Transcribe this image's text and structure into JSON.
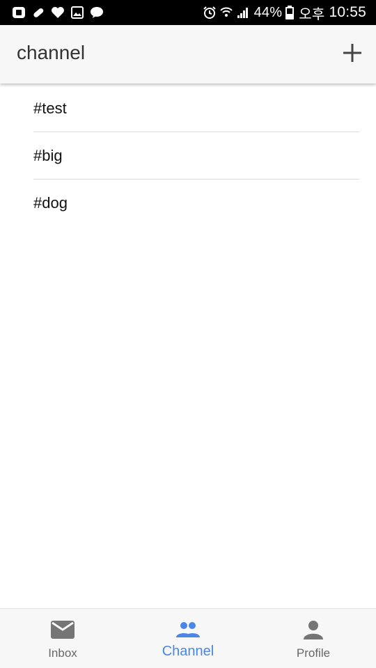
{
  "status_bar": {
    "battery_percent": "44%",
    "carrier": "오후",
    "time": "10:55",
    "left_icons": [
      "app-badge-icon",
      "pill-icon",
      "heart-icon",
      "gallery-icon",
      "talk-icon"
    ],
    "right_icons": [
      "alarm-icon",
      "wifi-icon",
      "signal-icon",
      "battery-icon"
    ]
  },
  "app_bar": {
    "title": "channel",
    "add_icon": "plus-icon"
  },
  "channels": [
    {
      "name": "#test"
    },
    {
      "name": "#big"
    },
    {
      "name": "#dog"
    }
  ],
  "bottom_nav": {
    "items": [
      {
        "label": "Inbox",
        "icon": "mail-icon",
        "active": false
      },
      {
        "label": "Channel",
        "icon": "group-icon",
        "active": true
      },
      {
        "label": "Profile",
        "icon": "person-icon",
        "active": false
      }
    ],
    "active_color": "#4a86e8",
    "inactive_color": "#666666"
  },
  "colors": {
    "status_bar_bg": "#000000",
    "app_bar_bg": "#f7f7f7",
    "divider": "#dddddd"
  }
}
